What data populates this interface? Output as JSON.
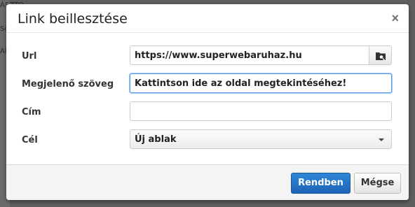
{
  "background": {
    "lines": [
      "ÁSZTO",
      "So",
      "Al"
    ]
  },
  "dialog": {
    "title": "Link beillesztése",
    "close_symbol": "×",
    "fields": {
      "url_label": "Url",
      "url_value": "https://www.superwebaruhaz.hu",
      "browse_icon": "browse-folder-icon",
      "display_text_label": "Megjelenő szöveg",
      "display_text_value": "Kattintson ide az oldal megtekintéséhez!",
      "title_label": "Cím",
      "title_value": "",
      "target_label": "Cél",
      "target_value": "Új ablak"
    },
    "buttons": {
      "ok": "Rendben",
      "cancel": "Mégse"
    }
  },
  "colors": {
    "primary_button": "#1d64b5",
    "focus_border": "#5aa0e8",
    "overlay": "#5e5e5e"
  }
}
